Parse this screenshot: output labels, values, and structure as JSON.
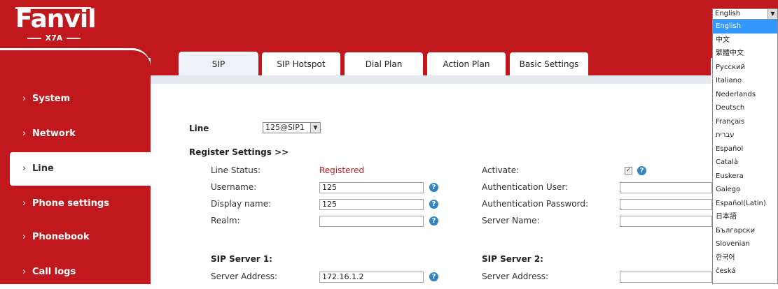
{
  "brand": {
    "logo": "Fanvil",
    "model": "X7A"
  },
  "language": {
    "selected": "English",
    "options": [
      "English",
      "中文",
      "繁體中文",
      "Русский",
      "Italiano",
      "Nederlands",
      "Deutsch",
      "Français",
      "עברית",
      "Español",
      "Català",
      "Euskera",
      "Galego",
      "Español(Latin)",
      "日本語",
      "Български",
      "Slovenian",
      "한국어",
      "česká"
    ]
  },
  "sidebar": {
    "items": [
      {
        "label": "System"
      },
      {
        "label": "Network"
      },
      {
        "label": "Line"
      },
      {
        "label": "Phone settings"
      },
      {
        "label": "Phonebook"
      },
      {
        "label": "Call logs"
      }
    ],
    "active": "Line"
  },
  "tabs": [
    {
      "label": "SIP"
    },
    {
      "label": "SIP Hotspot"
    },
    {
      "label": "Dial Plan"
    },
    {
      "label": "Action Plan"
    },
    {
      "label": "Basic Settings"
    }
  ],
  "form": {
    "line_label": "Line",
    "line_value": "125@SIP1",
    "register_heading": "Register Settings >>",
    "line_status_label": "Line Status:",
    "line_status_value": "Registered",
    "username_label": "Username:",
    "username_value": "125",
    "display_name_label": "Display name:",
    "display_name_value": "125",
    "realm_label": "Realm:",
    "realm_value": "",
    "activate_label": "Activate:",
    "auth_user_label": "Authentication User:",
    "auth_password_label": "Authentication Password:",
    "server_name_label": "Server Name:",
    "sip_server1_heading": "SIP Server 1:",
    "sip_server2_heading": "SIP Server 2:",
    "server_address_label": "Server Address:",
    "server_address_value": "172.16.1.2",
    "server_address2_label": "Server Address:"
  },
  "colors": {
    "brand_red": "#c0181d",
    "help_blue": "#2f85c9",
    "selected_blue": "#3399ff",
    "status_red": "#c0181d"
  }
}
